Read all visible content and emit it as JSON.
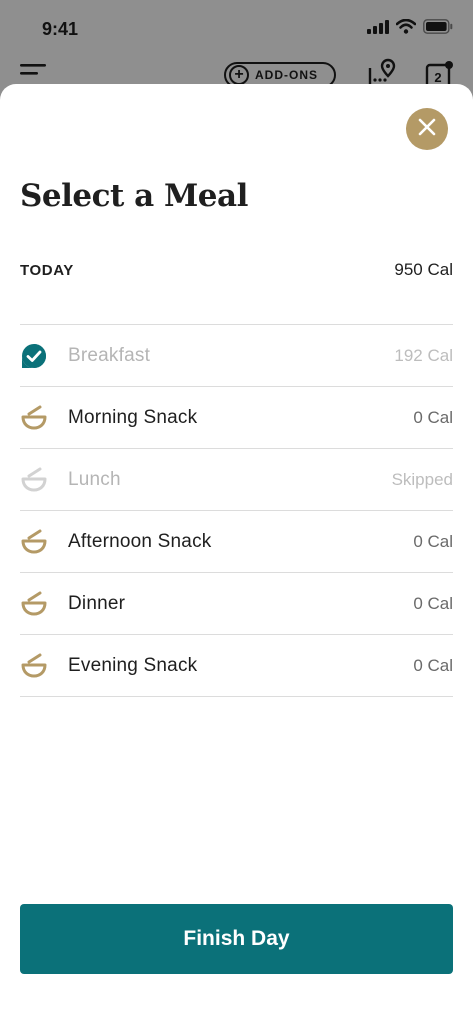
{
  "status_bar": {
    "time": "9:41"
  },
  "background_header": {
    "addons_label": "ADD-ONS",
    "calendar_badge": "2"
  },
  "sheet": {
    "title": "Select a Meal",
    "day_label": "TODAY",
    "day_total": "950 Cal",
    "meals": [
      {
        "name": "Breakfast",
        "calories": "192 Cal",
        "status": "logged",
        "icon": "checkmark-icon"
      },
      {
        "name": "Morning Snack",
        "calories": "0 Cal",
        "status": "open",
        "icon": "bowl-icon"
      },
      {
        "name": "Lunch",
        "calories": "Skipped",
        "status": "skipped",
        "icon": "bowl-icon"
      },
      {
        "name": "Afternoon Snack",
        "calories": "0 Cal",
        "status": "open",
        "icon": "bowl-icon"
      },
      {
        "name": "Dinner",
        "calories": "0 Cal",
        "status": "open",
        "icon": "bowl-icon"
      },
      {
        "name": "Evening Snack",
        "calories": "0 Cal",
        "status": "open",
        "icon": "bowl-icon"
      }
    ],
    "finish_button": "Finish Day"
  },
  "colors": {
    "accent_gold": "#b49a66",
    "accent_teal": "#0b7179",
    "muted_gray": "#cfcfcf"
  }
}
